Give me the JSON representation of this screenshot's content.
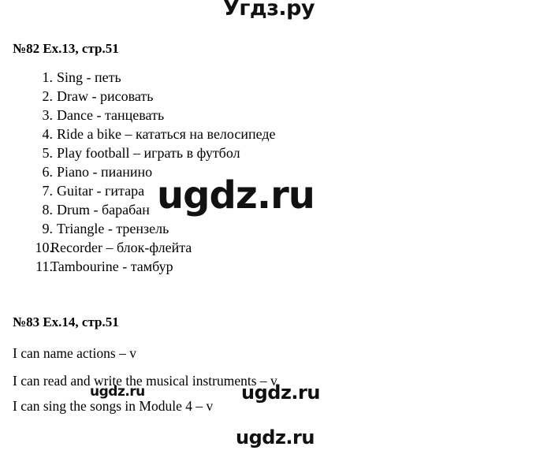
{
  "watermarks": {
    "top": "Угдз.ру",
    "middle": "ugdz.ru",
    "lower_left": "ugdz.ru",
    "lower_right": "ugdz.ru",
    "bottom": "ugdz.ru"
  },
  "exercises": [
    {
      "header": "№82 Ex.13, стр.51",
      "items": [
        {
          "num": "1.",
          "text": "Sing - петь"
        },
        {
          "num": "2.",
          "text": "Draw - рисовать"
        },
        {
          "num": "3.",
          "text": "Dance - танцевать"
        },
        {
          "num": "4.",
          "text": "Ride a bike – кататься на велосипеде"
        },
        {
          "num": "5.",
          "text": "Play football – играть в футбол"
        },
        {
          "num": "6.",
          "text": "Piano - пианино"
        },
        {
          "num": "7.",
          "text": "Guitar - гитара"
        },
        {
          "num": "8.",
          "text": "Drum - барабан"
        },
        {
          "num": "9.",
          "text": "Triangle - трензель"
        },
        {
          "num": "10.",
          "text": "Recorder – блок-флейта"
        },
        {
          "num": "11.",
          "text": "Tambourine  - тамбур"
        }
      ]
    },
    {
      "header": "№83 Ex.14, стр.51",
      "statements": [
        "I can name actions – v",
        "I can read and write the musical instruments – v",
        "I can sing the songs in Module 4 – v"
      ]
    }
  ]
}
